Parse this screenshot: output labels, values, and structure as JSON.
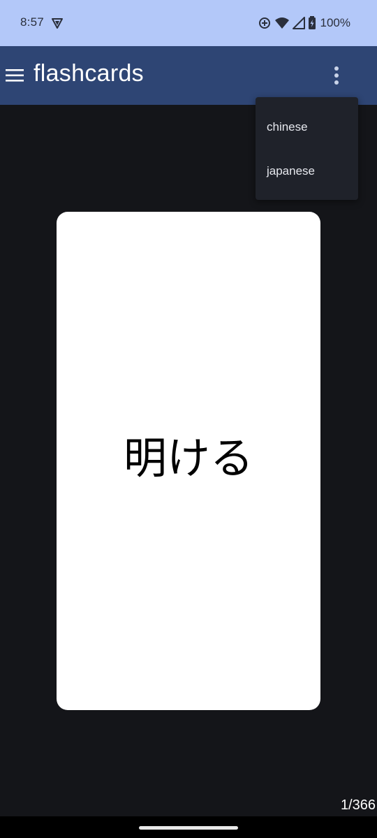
{
  "status_bar": {
    "time": "8:57",
    "battery": "100%",
    "icons": [
      "vpn-shield-icon",
      "data-saver-icon",
      "wifi-icon",
      "signal-icon",
      "battery-charging-icon"
    ],
    "background": "#b3c8f9"
  },
  "app_bar": {
    "title": "flashcards",
    "menu_icon": "hamburger-menu-icon",
    "overflow_icon": "more-vertical-icon",
    "background": "#2e4574"
  },
  "dropdown": {
    "items": [
      {
        "label": "chinese"
      },
      {
        "label": "japanese"
      }
    ],
    "background": "#1f222a"
  },
  "flashcard": {
    "word": "明ける",
    "background": "#ffffff"
  },
  "counter": {
    "text": "1/366"
  },
  "colors": {
    "page_background": "#141519"
  }
}
